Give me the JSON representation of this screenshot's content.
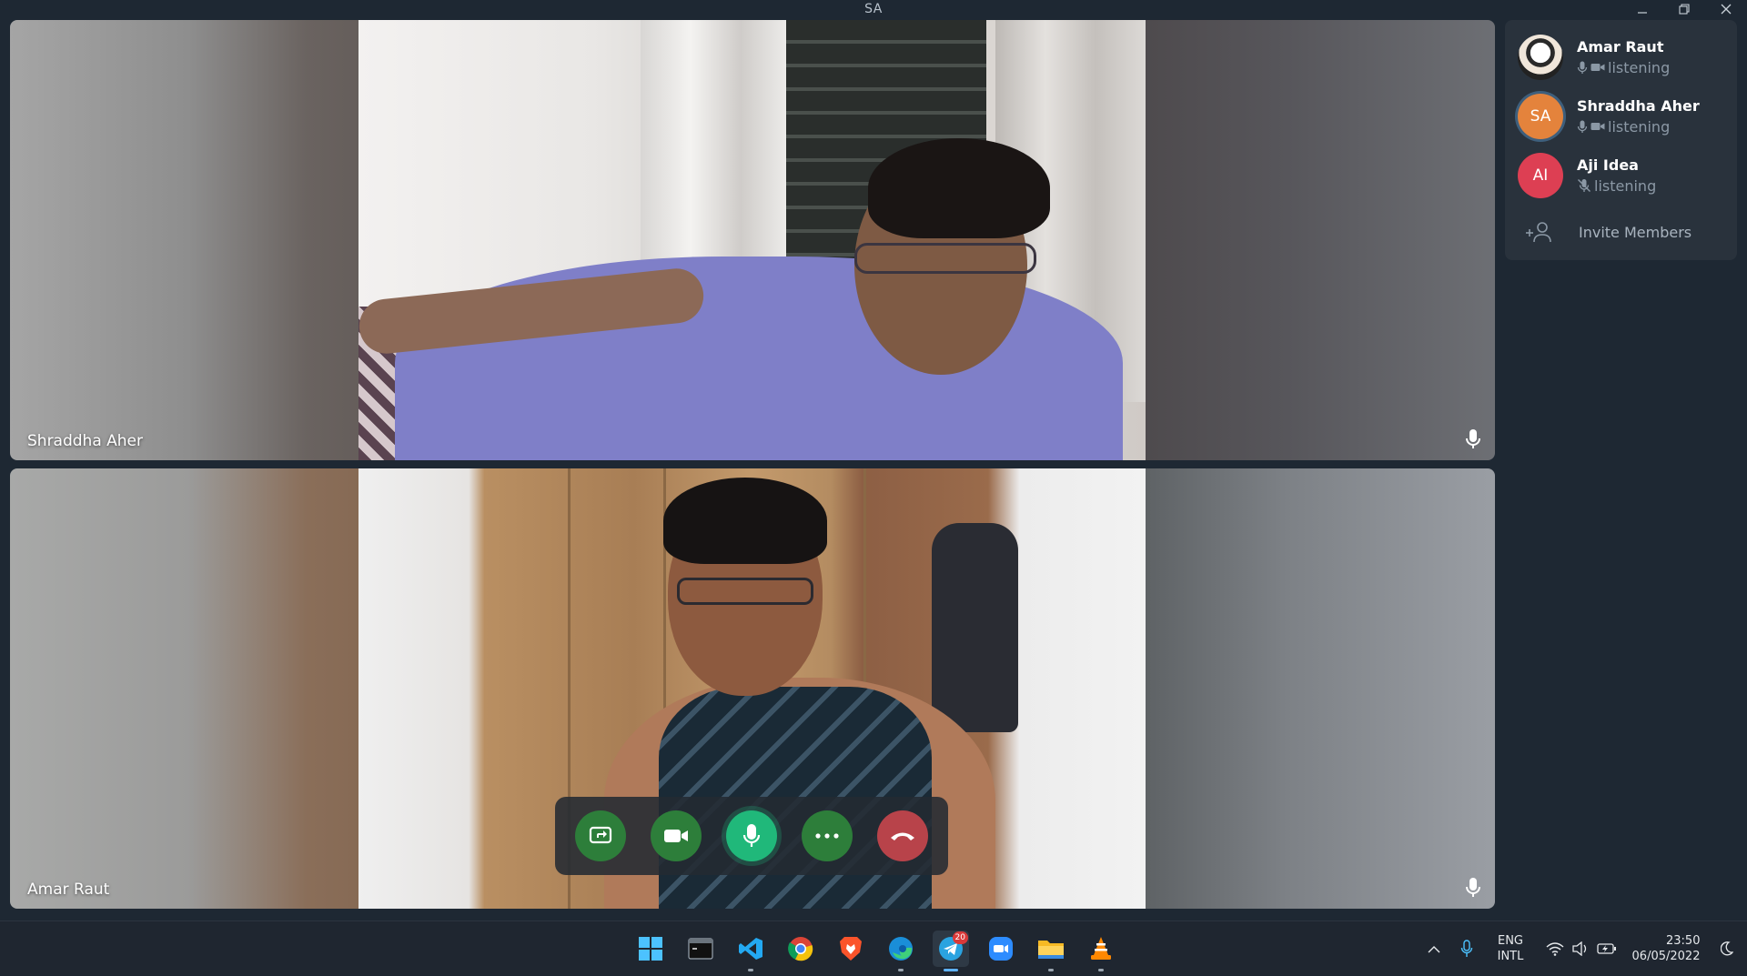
{
  "window": {
    "title": "SA",
    "controls": [
      "minimize",
      "restore",
      "close"
    ]
  },
  "tiles": [
    {
      "name": "Shraddha Aher",
      "mic_icon": "microphone-icon"
    },
    {
      "name": "Amar Raut",
      "mic_icon": "microphone-icon"
    }
  ],
  "controls": [
    {
      "name": "screen-share",
      "icon": "screen-share-icon",
      "color": "#2d7e3a"
    },
    {
      "name": "camera",
      "icon": "video-camera-icon",
      "color": "#2d7e3a"
    },
    {
      "name": "microphone",
      "icon": "microphone-icon",
      "color": "#20b87a"
    },
    {
      "name": "more",
      "icon": "more-icon",
      "color": "#2d7e3a"
    },
    {
      "name": "end-call",
      "icon": "hang-up-icon",
      "color": "#b8434a"
    }
  ],
  "participants": [
    {
      "name": "Amar Raut",
      "initials": "",
      "avatar_color": "",
      "status": "listening",
      "muted": false
    },
    {
      "name": "Shraddha Aher",
      "initials": "SA",
      "avatar_color": "#e4833c",
      "status": "listening",
      "muted": false
    },
    {
      "name": "Aji Idea",
      "initials": "AI",
      "avatar_color": "#dd3f53",
      "status": "listening",
      "muted": true
    }
  ],
  "invite": {
    "label": "Invite Members"
  },
  "taskbar": {
    "apps": [
      "windows-start",
      "terminal",
      "vscode",
      "chrome",
      "brave",
      "edge",
      "telegram",
      "zoom",
      "file-explorer",
      "vlc"
    ],
    "telegram_badge": "20",
    "language": {
      "line1": "ENG",
      "line2": "INTL"
    },
    "time": "23:50",
    "date": "06/05/2022"
  }
}
